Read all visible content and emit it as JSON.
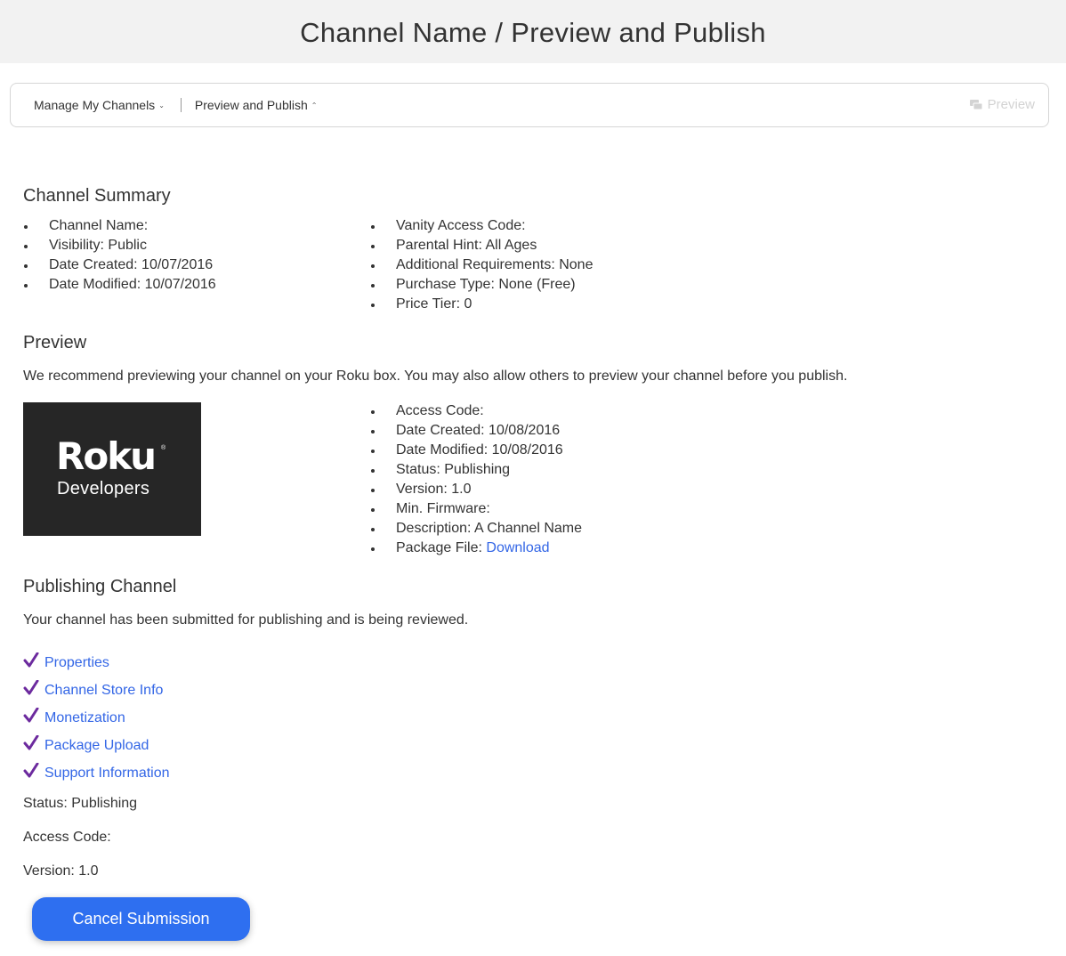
{
  "header": {
    "title": "Channel Name / Preview and Publish"
  },
  "navbar": {
    "manage_label": "Manage My Channels",
    "preview_publish_label": "Preview and Publish",
    "preview_button_label": "Preview"
  },
  "summary": {
    "heading": "Channel Summary",
    "left": [
      "Channel Name:",
      "Visibility: Public",
      "Date Created: 10/07/2016",
      "Date Modified: 10/07/2016"
    ],
    "right": [
      "Vanity Access Code:",
      "Parental Hint: All Ages",
      "Additional Requirements: None",
      "Purchase Type: None (Free)",
      "Price Tier: 0"
    ]
  },
  "preview": {
    "heading": "Preview",
    "description": "We recommend previewing your channel on your Roku box. You may also allow others to preview your channel before you publish.",
    "logo_text": "Roku",
    "logo_subtext": "Developers",
    "details": [
      "Access Code:",
      "Date Created: 10/08/2016",
      "Date Modified: 10/08/2016",
      "Status: Publishing",
      "Version: 1.0",
      "Min. Firmware:",
      "Description: A Channel Name"
    ],
    "package_file_label": "Package File:",
    "package_file_link": "Download"
  },
  "publishing": {
    "heading": "Publishing Channel",
    "message": "Your channel has been submitted for publishing and is being reviewed.",
    "completed_steps": [
      "Properties",
      "Channel Store Info",
      "Monetization",
      "Package Upload",
      "Support Information"
    ],
    "status": "Status: Publishing",
    "access_code": "Access Code:",
    "version": "Version: 1.0",
    "cancel_button": "Cancel Submission"
  },
  "colors": {
    "link": "#3366e6",
    "check": "#6c2a9e",
    "button": "#2e6ff0",
    "header_bg": "#f2f2f2"
  }
}
